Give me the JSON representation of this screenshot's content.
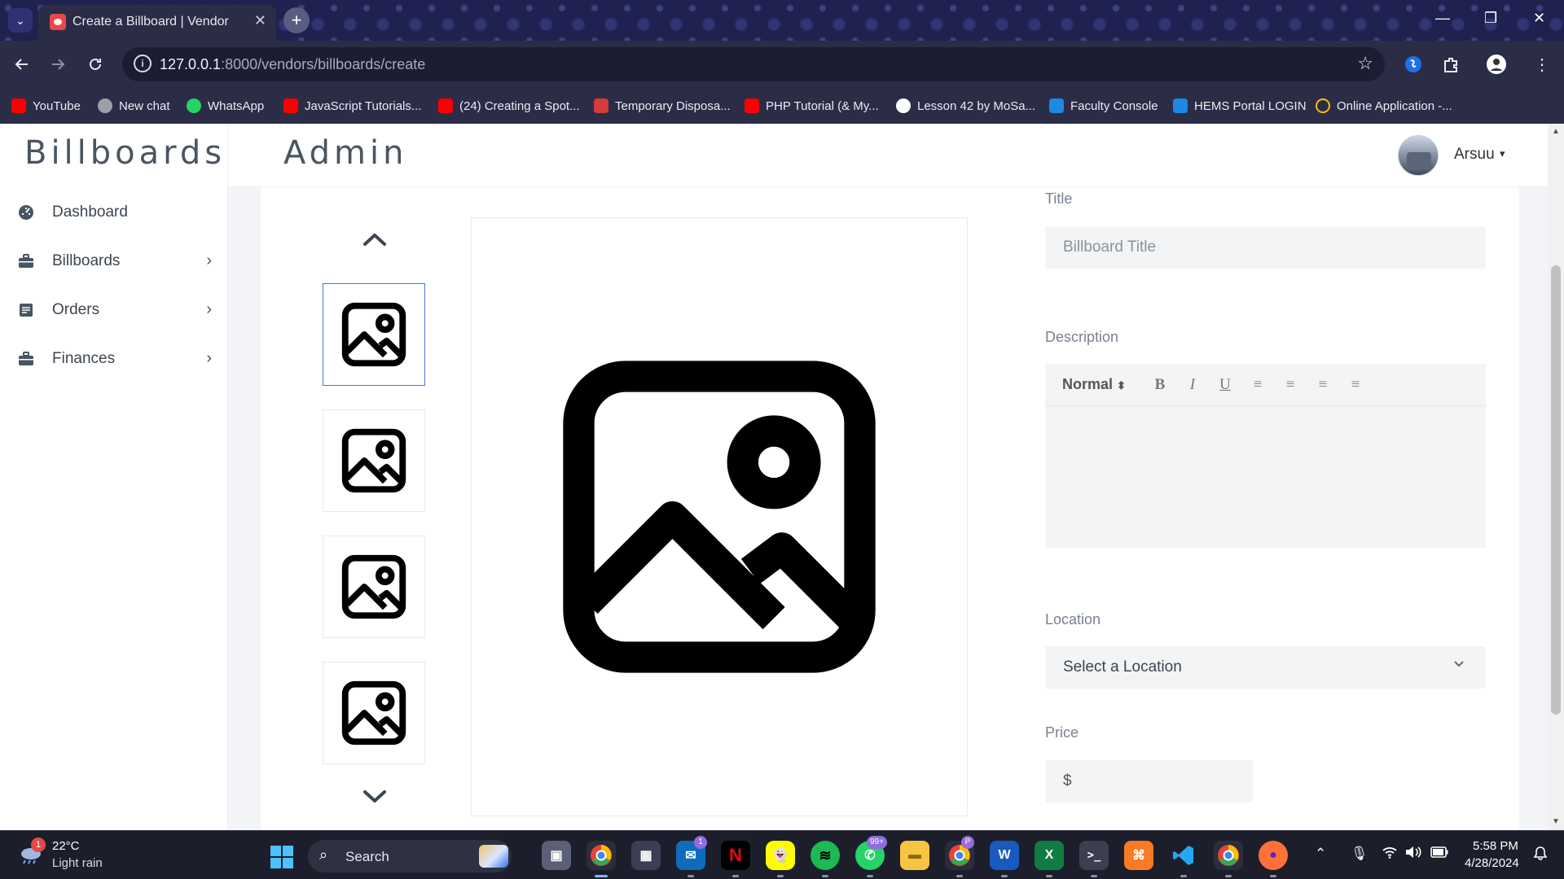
{
  "browser": {
    "tab_title": "Create a Billboard | Vendor",
    "tab_close": "✕",
    "new_tab": "+",
    "url_host": "127.0.0.1",
    "url_path": ":8000/vendors/billboards/create",
    "window_minimize": "—",
    "window_restore": "❐",
    "window_close": "✕",
    "bookmarks": [
      {
        "label": "YouTube",
        "icon": "youtube-icon",
        "color": "#ff0000"
      },
      {
        "label": "New chat",
        "icon": "chatgpt-icon",
        "color": "#9aa0a6"
      },
      {
        "label": "WhatsApp",
        "icon": "whatsapp-icon",
        "color": "#25d366"
      },
      {
        "label": "JavaScript Tutorials...",
        "icon": "youtube-icon",
        "color": "#ff0000"
      },
      {
        "label": "(24) Creating a Spot...",
        "icon": "youtube-icon",
        "color": "#ff0000"
      },
      {
        "label": "Temporary Disposa...",
        "icon": "mail-icon",
        "color": "#d43b3b"
      },
      {
        "label": "PHP Tutorial (& My...",
        "icon": "youtube-icon",
        "color": "#ff0000"
      },
      {
        "label": "Lesson 42 by MoSa...",
        "icon": "github-icon",
        "color": "#ffffff"
      },
      {
        "label": "Faculty Console",
        "icon": "f-icon",
        "color": "#1e88e5"
      },
      {
        "label": "HEMS Portal LOGIN",
        "icon": "f-icon",
        "color": "#1e88e5"
      },
      {
        "label": "Online Application -...",
        "icon": "globe-icon",
        "color": "#f4c20d"
      }
    ]
  },
  "sidebar": {
    "brand": "Billboards",
    "items": [
      {
        "label": "Dashboard",
        "icon": "dashboard-icon",
        "has_chevron": false
      },
      {
        "label": "Billboards",
        "icon": "briefcase-icon",
        "has_chevron": true
      },
      {
        "label": "Orders",
        "icon": "orders-icon",
        "has_chevron": true
      },
      {
        "label": "Finances",
        "icon": "briefcase-icon",
        "has_chevron": true
      }
    ],
    "chevron": "›"
  },
  "header": {
    "title": "Admin",
    "user_name": "Arsuu",
    "user_caret": "▾"
  },
  "gallery": {
    "thumb_count": 4,
    "selected_index": 0
  },
  "form": {
    "title_label": "Title",
    "title_placeholder": "Billboard Title",
    "description_label": "Description",
    "editor": {
      "format": "Normal",
      "format_arrows": "⬍",
      "bold": "B",
      "italic": "I",
      "underline": "U",
      "align_left": "≡",
      "align_center": "≡",
      "align_right": "≡",
      "justify": "≡"
    },
    "location_label": "Location",
    "location_value": "Select a Location",
    "price_label": "Price",
    "price_prefix": "$"
  },
  "taskbar": {
    "weather_badge": "1",
    "weather_temp": "22°C",
    "weather_desc": "Light rain",
    "search_label": "Search",
    "mail_badge": "1",
    "whatsapp_badge": "99+",
    "chrome_profile_badge": "P",
    "time": "5:58 PM",
    "date": "4/28/2024"
  },
  "colors": {
    "accent": "#3d7bd6",
    "chrome_bg": "#2b2d47",
    "taskbar_bg": "#1c1f2b"
  }
}
